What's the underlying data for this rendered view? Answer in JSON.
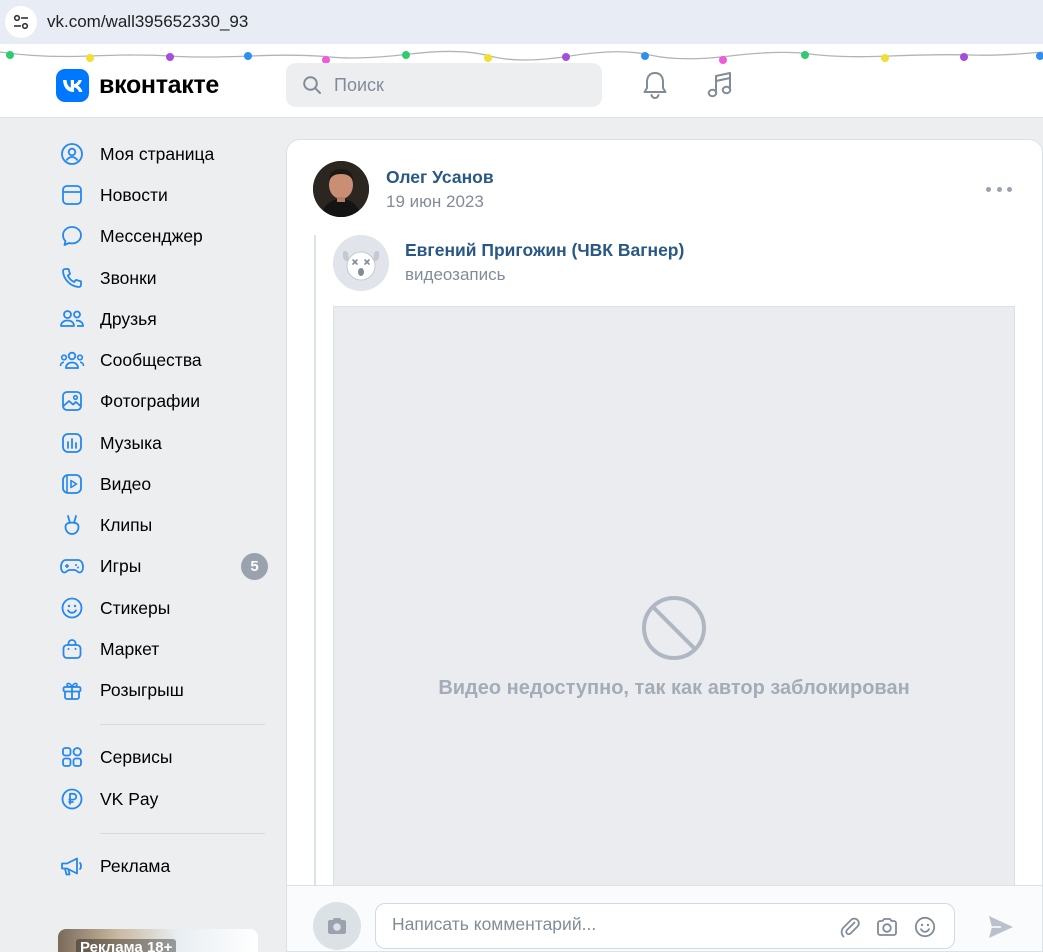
{
  "browser": {
    "url": "vk.com/wall395652330_93"
  },
  "header": {
    "logo_text": "вконтакте",
    "search_placeholder": "Поиск",
    "brand_color": "#0077ff"
  },
  "sidebar": {
    "items": [
      {
        "label": "Моя страница",
        "icon": "user-circle-icon"
      },
      {
        "label": "Новости",
        "icon": "news-icon"
      },
      {
        "label": "Мессенджер",
        "icon": "message-icon"
      },
      {
        "label": "Звонки",
        "icon": "phone-icon"
      },
      {
        "label": "Друзья",
        "icon": "friends-icon"
      },
      {
        "label": "Сообщества",
        "icon": "communities-icon"
      },
      {
        "label": "Фотографии",
        "icon": "photo-icon"
      },
      {
        "label": "Музыка",
        "icon": "music-icon"
      },
      {
        "label": "Видео",
        "icon": "video-icon"
      },
      {
        "label": "Клипы",
        "icon": "clips-icon"
      },
      {
        "label": "Игры",
        "icon": "gamepad-icon",
        "badge": "5"
      },
      {
        "label": "Стикеры",
        "icon": "smile-icon"
      },
      {
        "label": "Маркет",
        "icon": "bag-icon"
      },
      {
        "label": "Розыгрыш",
        "icon": "gift-icon"
      },
      {
        "label": "Сервисы",
        "icon": "grid-icon"
      },
      {
        "label": "VK Pay",
        "icon": "ruble-icon"
      },
      {
        "label": "Реклама",
        "icon": "megaphone-icon"
      }
    ],
    "ad_label": "Реклама 18+"
  },
  "post": {
    "author_name": "Олег Усанов",
    "date": "19 июн 2023",
    "repost": {
      "source_name": "Евгений Пригожин (ЧВК Вагнер)",
      "source_sub": "видеозапись"
    },
    "video_message": "Видео недоступно, так как автор заблокирован"
  },
  "comment": {
    "placeholder": "Написать комментарий..."
  }
}
